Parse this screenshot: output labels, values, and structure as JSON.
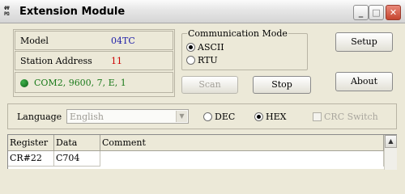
{
  "window": {
    "title": "Extension Module",
    "icon_text": "ΦΨ\nPΩ",
    "buttons": {
      "minimize": "_",
      "maximize": "□",
      "close": "✕"
    }
  },
  "info": {
    "model_label": "Model",
    "model_value": "04TC",
    "station_label": "Station Address",
    "station_value": "11",
    "connection": "COM2, 9600, 7, E, 1"
  },
  "comm_mode": {
    "title": "Communication Mode",
    "options": [
      "ASCII",
      "RTU"
    ],
    "selected": "ASCII"
  },
  "buttons": {
    "setup": "Setup",
    "about": "About",
    "scan": "Scan",
    "stop": "Stop"
  },
  "settings": {
    "language_label": "Language",
    "language_value": "English",
    "dec_label": "DEC",
    "hex_label": "HEX",
    "number_format": "HEX",
    "crc_label": "CRC Switch"
  },
  "table": {
    "columns": [
      "Register",
      "Data",
      "Comment"
    ],
    "rows": [
      {
        "register": "CR#22",
        "data": "C704",
        "comment": ""
      }
    ]
  },
  "colors": {
    "model_value": "#1c1ca8",
    "station_value": "#cc0000",
    "connection_text": "#1a7a1a",
    "status_dot": "#1d8a29"
  }
}
